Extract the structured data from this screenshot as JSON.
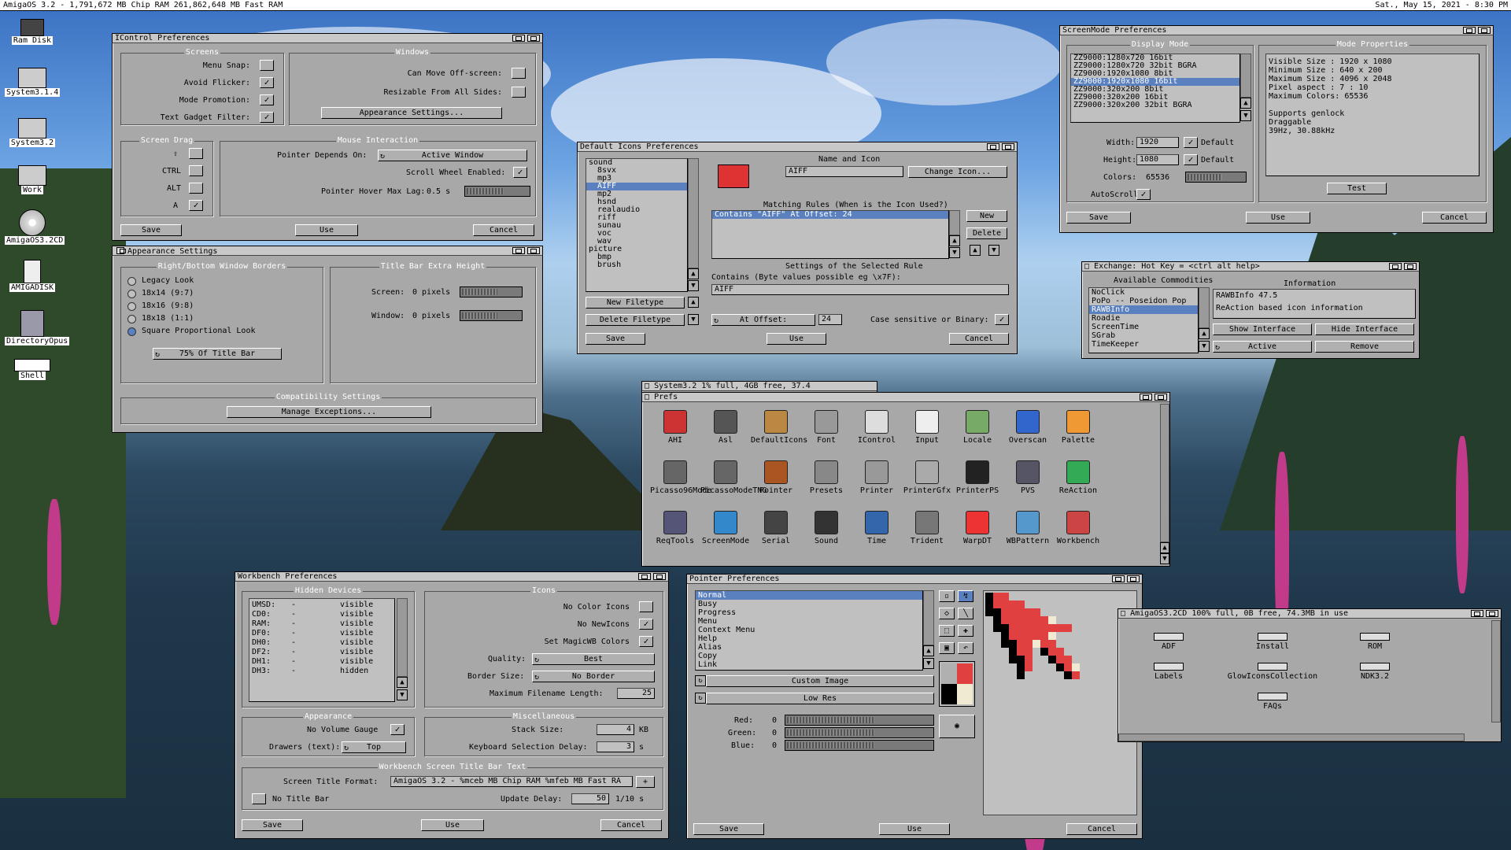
{
  "screen_bar": {
    "left": "AmigaOS 3.2 - 1,791,672 MB Chip RAM  261,862,648 MB Fast RAM",
    "right": "Sat., May 15, 2021 - 8:30 PM"
  },
  "desktop_icons": [
    {
      "label": "Ram Disk",
      "icon": "ram-disk-icon"
    },
    {
      "label": "System3.1.4",
      "icon": "drive-icon"
    },
    {
      "label": "System3.2",
      "icon": "drive-icon"
    },
    {
      "label": "Work",
      "icon": "drive-icon"
    },
    {
      "label": "AmigaOS3.2CD",
      "icon": "cd-icon"
    },
    {
      "label": "AMIGADISK",
      "icon": "disk-icon"
    },
    {
      "label": "DirectoryOpus",
      "icon": "app-icon"
    },
    {
      "label": "Shell",
      "icon": "shell-icon"
    }
  ],
  "icontrol": {
    "title": "IControl Preferences",
    "screens_label": "Screens",
    "menu_snap": "Menu Snap:",
    "avoid_flicker": "Avoid Flicker:",
    "mode_promotion": "Mode Promotion:",
    "text_gadget_filter": "Text Gadget Filter:",
    "windows_label": "Windows",
    "can_move": "Can Move Off-screen:",
    "resizable": "Resizable From All Sides:",
    "appearance_btn": "Appearance Settings...",
    "screen_drag_label": "Screen Drag",
    "ctrl": "CTRL",
    "alt": "ALT",
    "mouse_label": "Mouse Interaction",
    "pointer_depends": "Pointer Depends On:",
    "pointer_depends_value": "Active Window",
    "scroll_wheel": "Scroll Wheel Enabled:",
    "hover_lag": "Pointer Hover Max Lag:",
    "hover_lag_value": "0.5 s",
    "save": "Save",
    "use": "Use",
    "cancel": "Cancel"
  },
  "appearance": {
    "title": "Appearance Settings",
    "borders_label": "Right/Bottom Window Borders",
    "options": [
      "Legacy Look",
      "18x14 (9:7)",
      "18x16 (9:8)",
      "18x18 (1:1)",
      "Square Proportional Look"
    ],
    "selected_index": 4,
    "title_bar_pct": "75% Of Title Bar",
    "extra_label": "Title Bar Extra Height",
    "screen_label": "Screen:",
    "screen_value": "0 pixels",
    "window_label": "Window:",
    "window_value": "0 pixels",
    "compat_label": "Compatibility Settings",
    "manage_btn": "Manage Exceptions..."
  },
  "default_icons": {
    "title": "Default Icons Preferences",
    "filetypes": [
      "sound",
      "8svx",
      "mp3",
      "AIFF",
      "mp2",
      "hsnd",
      "realaudio",
      "riff",
      "sunau",
      "voc",
      "wav",
      "picture",
      "bmp",
      "brush"
    ],
    "selected": "AIFF",
    "name_icon_label": "Name and Icon",
    "name_value": "AIFF",
    "change_icon": "Change Icon...",
    "matching_label": "Matching Rules (When is the Icon Used?)",
    "rule": "Contains \"AIFF\" At Offset: 24",
    "new": "New",
    "delete": "Delete",
    "settings_label": "Settings of the Selected Rule",
    "contains_label": "Contains (Byte values possible eg \\x7F):",
    "contains_value": "AIFF",
    "at_offset": "At Offset:",
    "offset_value": "24",
    "case_label": "Case sensitive or Binary:",
    "new_filetype": "New Filetype",
    "delete_filetype": "Delete Filetype",
    "save": "Save",
    "use": "Use",
    "cancel": "Cancel"
  },
  "screenmode": {
    "title": "ScreenMode Preferences",
    "display_label": "Display Mode",
    "modes": [
      "ZZ9000:1280x720 16bit",
      "ZZ9000:1280x720 32bit BGRA",
      "ZZ9000:1920x1080 8bit",
      "ZZ9000:1920x1080 16bit",
      "ZZ9000:320x200 8bit",
      "ZZ9000:320x200 16bit",
      "ZZ9000:320x200 32bit BGRA"
    ],
    "selected_mode": "ZZ9000:1920x1080 16bit",
    "width_label": "Width:",
    "width_value": "1920",
    "height_label": "Height:",
    "height_value": "1080",
    "default": "Default",
    "colors_label": "Colors:",
    "colors_value": "65536",
    "autoscroll": "AutoScroll:",
    "props_label": "Mode Properties",
    "props": [
      "Visible Size   :  1920 x  1080",
      "Minimum Size   :   640 x   200",
      "Maximum Size   :  4096 x  2048",
      "Pixel aspect   :     7 :    10",
      "Maximum Colors: 65536",
      "",
      "Supports genlock",
      "Draggable",
      "39Hz, 30.88kHz"
    ],
    "test": "Test",
    "save": "Save",
    "use": "Use",
    "cancel": "Cancel"
  },
  "exchange": {
    "title": "Exchange: Hot Key = <ctrl alt help>",
    "available_label": "Available Commodities",
    "commodities": [
      "NoClick",
      "PoPo -- Poseidon Pop",
      "RAWBInfo",
      "Roadie",
      "ScreenTime",
      "SGrab",
      "TimeKeeper"
    ],
    "selected": "RAWBInfo",
    "info_label": "Information",
    "info": [
      "RAWBInfo 47.5",
      "ReAction based icon information"
    ],
    "show": "Show Interface",
    "hide": "Hide Interface",
    "active": "Active",
    "remove": "Remove"
  },
  "system_drawer": {
    "title": "System3.2  1% full, 4GB free, 37.4"
  },
  "prefs": {
    "title": "Prefs",
    "icons": [
      "AHI",
      "Asl",
      "DefaultIcons",
      "Font",
      "IControl",
      "Input",
      "Locale",
      "Overscan",
      "Palette",
      "Picasso96Mode",
      "PicassoModeTNG",
      "Pointer",
      "Presets",
      "Printer",
      "PrinterGfx",
      "PrinterPS",
      "PVS",
      "ReAction",
      "ReqTools",
      "ScreenMode",
      "Serial",
      "Sound",
      "Time",
      "Trident",
      "WarpDT",
      "WBPattern",
      "Workbench"
    ]
  },
  "workbench": {
    "title": "Workbench Preferences",
    "hidden_label": "Hidden Devices",
    "devices": [
      [
        "UMSD:",
        "-",
        "visible"
      ],
      [
        "CD0:",
        "-",
        "visible"
      ],
      [
        "RAM:",
        "-",
        "visible"
      ],
      [
        "DF0:",
        "-",
        "visible"
      ],
      [
        "DH0:",
        "-",
        "visible"
      ],
      [
        "DF2:",
        "-",
        "visible"
      ],
      [
        "DH1:",
        "-",
        "visible"
      ],
      [
        "DH3:",
        "-",
        "hidden"
      ]
    ],
    "icons_label": "Icons",
    "no_color_icons": "No Color Icons",
    "no_newicons": "No NewIcons",
    "set_magicwb": "Set MagicWB Colors",
    "quality": "Quality:",
    "quality_value": "Best",
    "border_size": "Border Size:",
    "border_value": "No Border",
    "max_filename": "Maximum Filename Length:",
    "max_filename_value": "25",
    "appearance_label": "Appearance",
    "no_volume_gauge": "No Volume Gauge",
    "drawers": "Drawers (text):",
    "drawers_value": "Top",
    "misc_label": "Miscellaneous",
    "stack_size": "Stack Size:",
    "stack_value": "4",
    "kb": "KB",
    "kbd_delay": "Keyboard Selection Delay:",
    "kbd_value": "3",
    "s": "s",
    "title_bar_label": "Workbench Screen Title Bar Text",
    "title_format": "Screen Title Format:",
    "title_format_value": "AmigaOS 3.2 - %mceb MB Chip RAM  %mfeb MB Fast RA",
    "no_title_bar": "No Title Bar",
    "update_delay": "Update Delay:",
    "update_value": "50",
    "update_unit": "1/10 s",
    "save": "Save",
    "use": "Use",
    "cancel": "Cancel"
  },
  "pointer": {
    "title": "Pointer Preferences",
    "types": [
      "Normal",
      "Busy",
      "Progress",
      "Menu",
      "Context Menu",
      "Help",
      "Alias",
      "Copy",
      "Link"
    ],
    "selected": "Normal",
    "custom_image": "Custom Image",
    "low_res": "Low Res",
    "red": "Red:",
    "green": "Green:",
    "blue": "Blue:",
    "red_value": "0",
    "green_value": "0",
    "blue_value": "0",
    "save": "Save",
    "use": "Use",
    "cancel": "Cancel"
  },
  "cd_drawer": {
    "title": "AmigaOS3.2CD  100% full, 0B free, 74.3MB in use",
    "items": [
      "ADF",
      "Install",
      "ROM",
      "Labels",
      "GlowIconsCollection",
      "NDK3.2",
      "FAQs"
    ]
  },
  "colors": {
    "window_bg": "#a8a8a8",
    "select": "#5a80c0",
    "pointer_red": "#e04040"
  }
}
